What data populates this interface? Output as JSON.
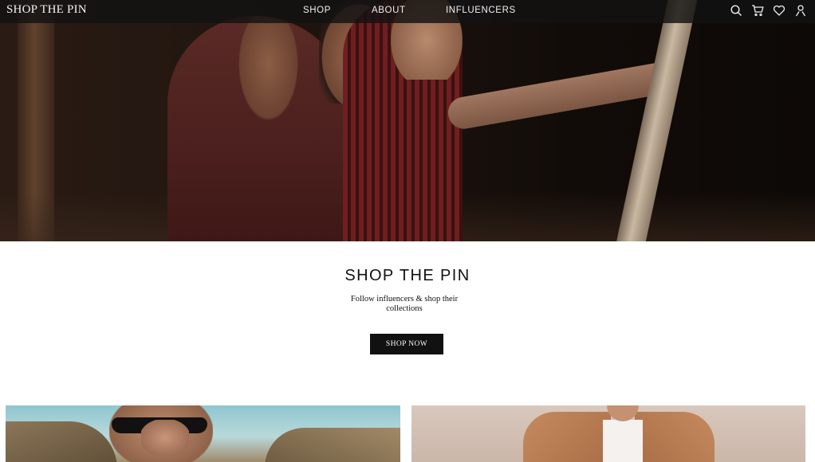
{
  "header": {
    "logo": "SHOP THE PIN",
    "nav": [
      {
        "label": "SHOP"
      },
      {
        "label": "ABOUT"
      },
      {
        "label": "INFLUENCERS"
      }
    ],
    "icons": [
      "search-icon",
      "cart-icon",
      "heart-icon",
      "user-icon"
    ]
  },
  "hero": {
    "image": "hero-photo"
  },
  "promo": {
    "title": "SHOP THE PIN",
    "subtitle": "Follow influencers & shop their collections",
    "cta_label": "SHOP NOW"
  },
  "tiles": [
    {
      "image": "influencer-photo-sunglasses"
    },
    {
      "image": "influencer-photo-jacket"
    }
  ],
  "colors": {
    "nav_background": "#121212",
    "button_background": "#111111",
    "text_dark": "#111111"
  }
}
